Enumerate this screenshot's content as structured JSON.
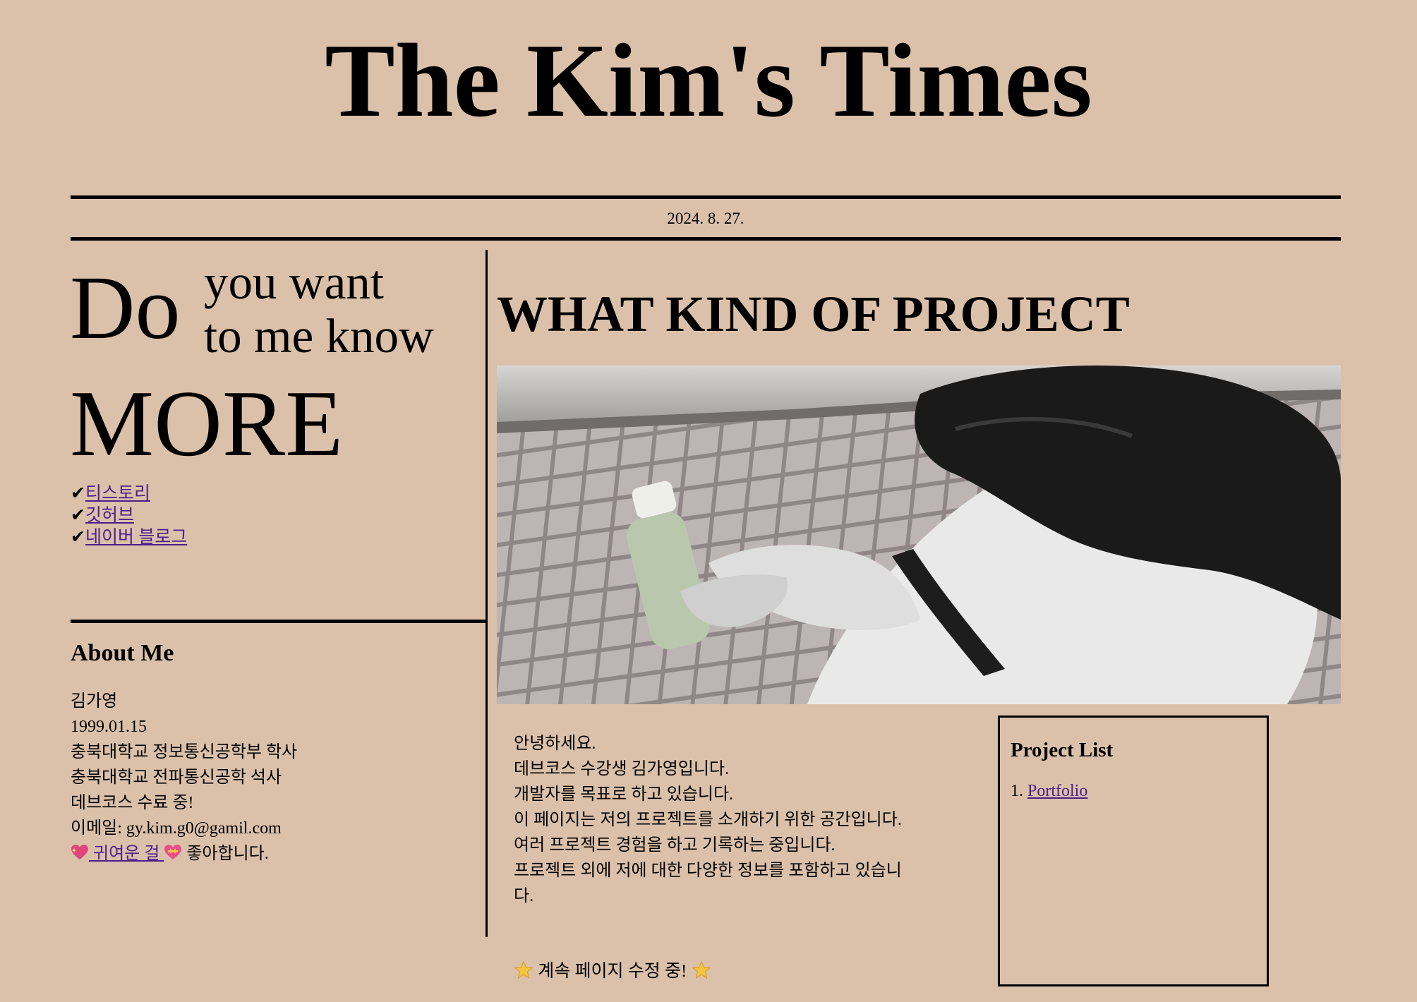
{
  "masthead": {
    "title": "The Kim's Times"
  },
  "dateline": {
    "date": "2024. 8. 27."
  },
  "teaser": {
    "word1": "Do",
    "line1": "you want",
    "line2": "to me know",
    "word2": "MORE"
  },
  "links": {
    "check": "✔",
    "items": [
      {
        "label": "티스토리"
      },
      {
        "label": "깃허브"
      },
      {
        "label": "네이버 블로그"
      }
    ]
  },
  "about": {
    "heading": "About Me",
    "name": "김가영",
    "birth": "1999.01.15",
    "edu1": "충북대학교 정보통신공학부 학사",
    "edu2": "충북대학교 전파통신공학 석사",
    "course": "데브코스 수료 중!",
    "email_prefix": "이메일: ",
    "email": "gy.kim.g0@gamil.com",
    "cute_link": "귀여운 걸",
    "cute_suffix": "좋아합니다."
  },
  "main": {
    "headline": "WHAT KIND OF PROJECT",
    "photo_icon": "photo",
    "intro": [
      "안녕하세요.",
      "데브코스 수강생 김가영입니다.",
      "개발자를 목표로 하고 있습니다.",
      "이 페이지는 저의 프로젝트를 소개하기 위한 공간입니다. 여러 프로젝트 경험을 하고 기록하는 중입니다.",
      "프로젝트 외에 저에 대한 다양한 정보를 포함하고 있습니다."
    ],
    "notice": "계속 페이지 수정 중!"
  },
  "projects": {
    "heading": "Project List",
    "items": [
      {
        "num": "1. ",
        "label": "Portfolio"
      }
    ]
  },
  "colors": {
    "background": "#dbc1a9",
    "link": "#4b1e8c",
    "text": "#000000"
  }
}
